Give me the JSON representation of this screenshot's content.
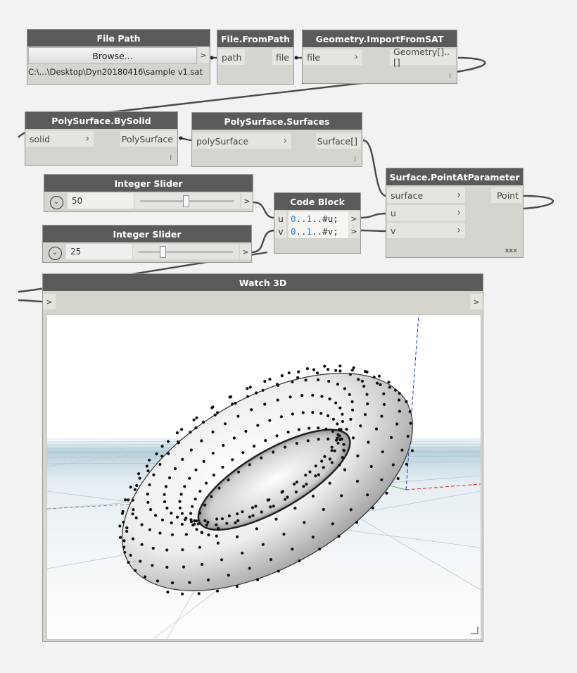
{
  "nodes": {
    "file_path": {
      "title": "File Path",
      "browse_label": "Browse...",
      "out_arrow": ">",
      "path_value": "C:\\...\\Desktop\\Dyn20180416\\sample v1.sat"
    },
    "file_from_path": {
      "title": "File.FromPath",
      "in_port": "path",
      "out_port": "file"
    },
    "import_sat": {
      "title": "Geometry.ImportFromSAT",
      "in_port": "file",
      "out_port": "Geometry[]..[]",
      "lacing": "l"
    },
    "polysurface_bysolid": {
      "title": "PolySurface.BySolid",
      "in_port": "solid",
      "out_port": "PolySurface",
      "lacing": "l"
    },
    "polysurface_surfaces": {
      "title": "PolySurface.Surfaces",
      "in_port": "polySurface",
      "out_port": "Surface[]",
      "lacing": "l"
    },
    "surface_point": {
      "title": "Surface.PointAtParameter",
      "in_ports": [
        "surface",
        "u",
        "v"
      ],
      "out_port": "Point",
      "lacing": "xxx"
    },
    "slider_u": {
      "title": "Integer Slider",
      "value": "50",
      "fraction": 0.49,
      "out_arrow": ">"
    },
    "slider_v": {
      "title": "Integer Slider",
      "value": "25",
      "fraction": 0.24,
      "out_arrow": ">"
    },
    "code_block": {
      "title": "Code Block",
      "lines": [
        {
          "var": "u",
          "p1": "0",
          "d1": "..",
          "p2": "1",
          "d2": "..#u;"
        },
        {
          "var": "v",
          "p1": "0",
          "d1": "..",
          "p2": "1",
          "d2": "..#v;"
        }
      ],
      "out_arrow": ">"
    },
    "watch3d": {
      "title": "Watch 3D",
      "in_arrow": ">",
      "out_arrow": ">"
    }
  },
  "chevron": "›",
  "dropdown_glyph": "⌄",
  "colors": {
    "header": "#5a5a5a",
    "node_body": "#d6d4cf",
    "wire": "#4a4a4a",
    "code_number": "#2e7fd7",
    "axis_red": "#d62222",
    "axis_green": "#22aa22",
    "axis_blue": "#2233bb"
  }
}
